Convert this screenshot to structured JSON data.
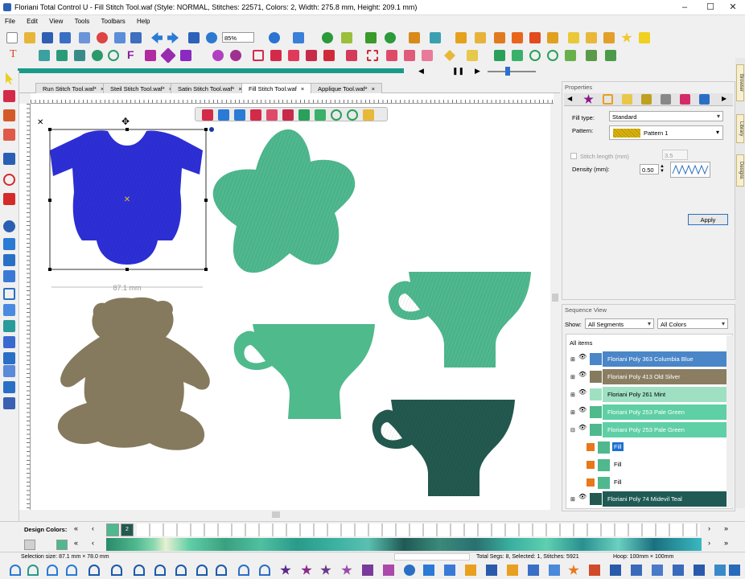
{
  "titlebar": {
    "title": "Floriani Total Control U - Fill Stitch Tool.waf (Style: NORMAL, Stitches: 22571, Colors: 2, Width: 275.8 mm, Height: 209.1 mm)"
  },
  "menu": [
    "File",
    "Edit",
    "View",
    "Tools",
    "Toolbars",
    "Help"
  ],
  "toolbar": {
    "zoom": "85%"
  },
  "tabs": [
    {
      "label": "Run Stitch Tool.waf*"
    },
    {
      "label": "Steil Stitch Tool.waf*"
    },
    {
      "label": "Satin Stitch Tool.waf*"
    },
    {
      "label": "Fill Stitch Tool.waf",
      "active": true
    },
    {
      "label": "Applique Tool.waf*"
    }
  ],
  "canvas": {
    "dimension_label": "87.1 mm"
  },
  "properties": {
    "header": "Properties",
    "fill_type_label": "Fill type:",
    "fill_type_value": "Standard",
    "pattern_label": "Pattern:",
    "pattern_value": "Pattern  1",
    "stitch_length_label": "Stitch length (mm)",
    "stitch_length_value": "3.5",
    "density_label": "Density (mm):",
    "density_value": "0.50",
    "apply_label": "Apply"
  },
  "sequence": {
    "header": "Sequence View",
    "show_label": "Show:",
    "segments_value": "All Segments",
    "colors_value": "All Colors",
    "all_items": "All items",
    "rows": [
      {
        "label": "Floriani Poly 363 Columbia Blue",
        "color": "#4a86c8"
      },
      {
        "label": "Floriani Poly 413 Old Silver",
        "color": "#8a7d62"
      },
      {
        "label": "Floriani Poly 261 Mint",
        "color": "#9fe0c3"
      },
      {
        "label": "Floriani Poly 253 Pale Green",
        "color": "#5fcfa6"
      },
      {
        "label": "Floriani Poly 253 Pale Green",
        "color": "#5fcfa6"
      },
      {
        "label": "Fill",
        "color": "#1e6fd0"
      },
      {
        "label": "Fill",
        "color": "#f0f0f0"
      },
      {
        "label": "Fill",
        "color": "#f0f0f0"
      },
      {
        "label": "Floriani Poly 74 Midevil Teal",
        "color": "#1f5a54"
      }
    ]
  },
  "side_tabs": [
    "Browser",
    "Library",
    "Designs"
  ],
  "design_colors": {
    "label": "Design Colors:",
    "index_badge": "2"
  },
  "status": {
    "selection": "Selection size: 87.1 mm × 78.0 mm",
    "totals": "Total Segs: 8, Selected: 1, Stitches: 5921",
    "hoop": "Hoop: 100mm × 100mm"
  },
  "colors": {
    "onesie": "#2d2fd6",
    "star": "#4fb88e",
    "bear": "#857a5e",
    "cup1": "#4fba8c",
    "cup2": "#4fb88e",
    "cup3": "#23594f"
  }
}
